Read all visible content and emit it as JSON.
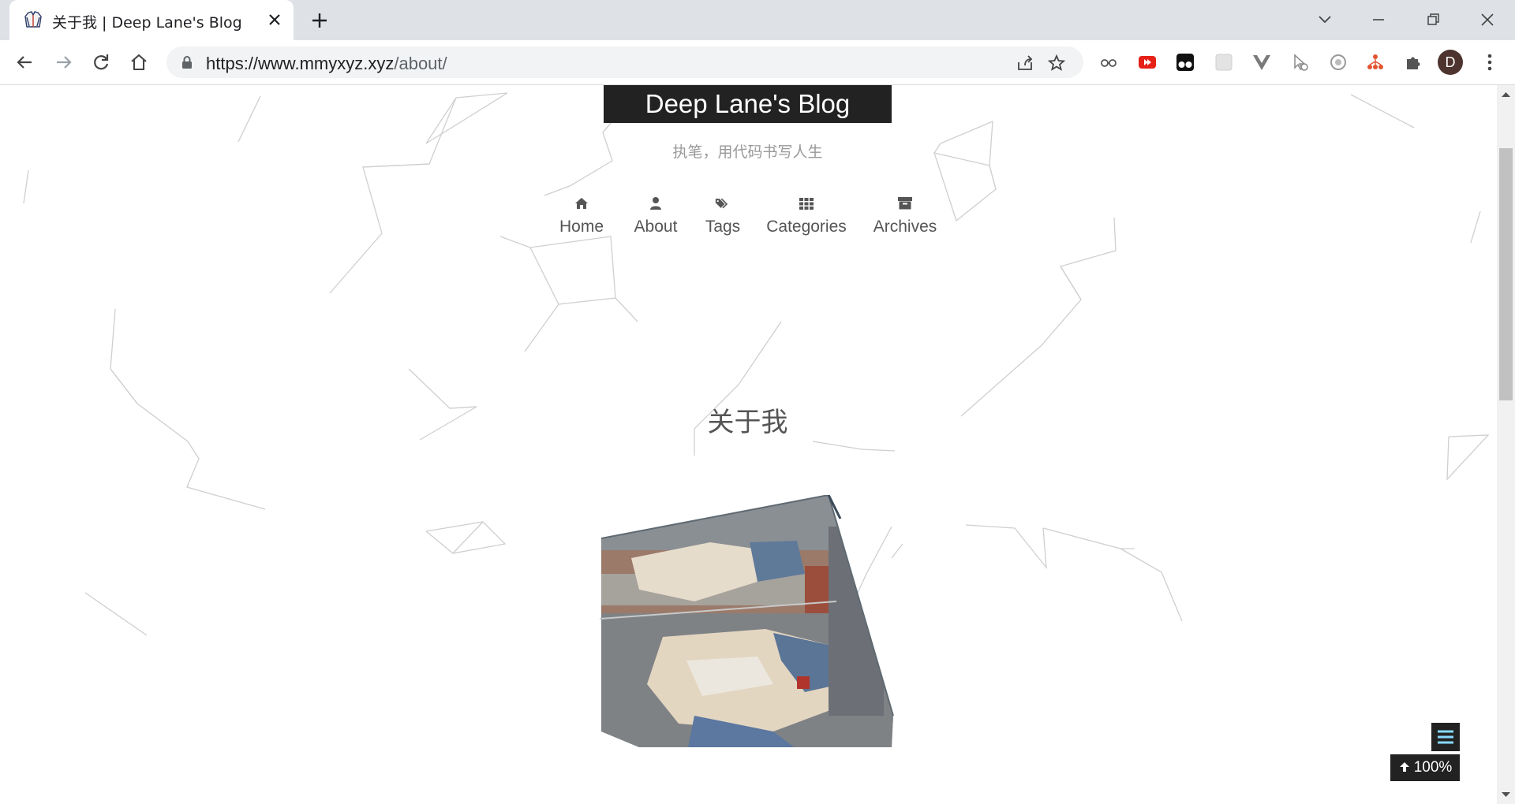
{
  "browser": {
    "tab_title": "关于我 | Deep Lane's Blog",
    "url_host": "https://www.mmyxyz.xyz",
    "url_path": "/about/",
    "profile_initial": "D"
  },
  "site": {
    "brand": "Deep Lane's Blog",
    "subtitle": "执笔，用代码书写人生",
    "menu": [
      {
        "label": "Home",
        "icon": "home-icon"
      },
      {
        "label": "About",
        "icon": "user-icon"
      },
      {
        "label": "Tags",
        "icon": "tags-icon"
      },
      {
        "label": "Categories",
        "icon": "grid-icon"
      },
      {
        "label": "Archives",
        "icon": "archive-icon"
      }
    ]
  },
  "post": {
    "title": "关于我"
  },
  "widgets": {
    "back_to_top_label": "100%"
  }
}
